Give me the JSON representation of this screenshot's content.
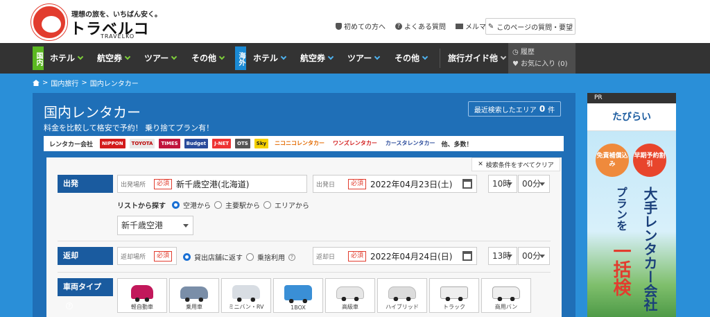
{
  "header": {
    "tagline": "理想の旅を、いちばん安く。",
    "logo_main": "トラベルコ",
    "logo_sub": "TRAVELKO",
    "links": [
      "初めての方へ",
      "よくある質問",
      "メルマガ"
    ],
    "faq_button": "このページの質問・要望"
  },
  "nav": {
    "domestic_tag": "国内",
    "overseas_tag": "海外",
    "domestic_items": [
      "ホテル",
      "航空券",
      "ツアー",
      "その他"
    ],
    "overseas_items": [
      "ホテル",
      "航空券",
      "ツアー",
      "その他"
    ],
    "guide": "旅行ガイド他",
    "history": "履歴",
    "favorites": "お気に入り (0)"
  },
  "breadcrumb": [
    "国内旅行",
    "国内レンタカー"
  ],
  "main": {
    "title": "国内レンタカー",
    "subtitle": "料金を比較して格安で予約！ 乗り捨てプラン有！",
    "recent_label": "最近検索したエリア",
    "recent_count": "0",
    "recent_unit": "件",
    "logos_label": "レンタカー会社",
    "logo_brands": [
      "NIPPON",
      "TOYOTA",
      "TIMES",
      "Budget",
      "J-NET",
      "OTS",
      "Sky",
      "ニコニコレンタカー",
      "ワンズレンタカー",
      "カースタレンタカー"
    ],
    "logos_more": "他、多数！"
  },
  "form": {
    "clear": "検索条件をすべてクリア",
    "required": "必須",
    "departure": {
      "label": "出発",
      "place_label": "出発場所",
      "place_value": "新千歳空港(北海道)",
      "date_label": "出発日",
      "date_value": "2022年04月23日(土)",
      "hour": "10時",
      "minute": "00分",
      "list_label": "リストから探す",
      "list_options": [
        "空港から",
        "主要駅から",
        "エリアから"
      ],
      "airport_select": "新千歳空港"
    },
    "return": {
      "label": "返却",
      "place_label": "返却場所",
      "options": [
        "貸出店舗に返す",
        "乗捨利用"
      ],
      "date_label": "返却日",
      "date_value": "2022年04月24日(日)",
      "hour": "13時",
      "minute": "00分"
    },
    "car_type": {
      "label": "車両タイプ",
      "types": [
        "軽自動車",
        "乗用車",
        "ミニバン・RV",
        "1BOX",
        "高級車",
        "ハイブリッド",
        "トラック",
        "商用バン"
      ]
    }
  },
  "ad": {
    "pr": "PR",
    "brand": "たびらい",
    "bubble1": "免責補償込み",
    "bubble2": "早期予約割引",
    "text1": "プランを",
    "text2": "大手レンタカー会社",
    "text3": "一括検"
  },
  "colors": {
    "brand_red": "#e23c2e",
    "panel_blue": "#1f6fb7",
    "domestic_green": "#5bb821",
    "overseas_blue": "#1a8ad4"
  }
}
